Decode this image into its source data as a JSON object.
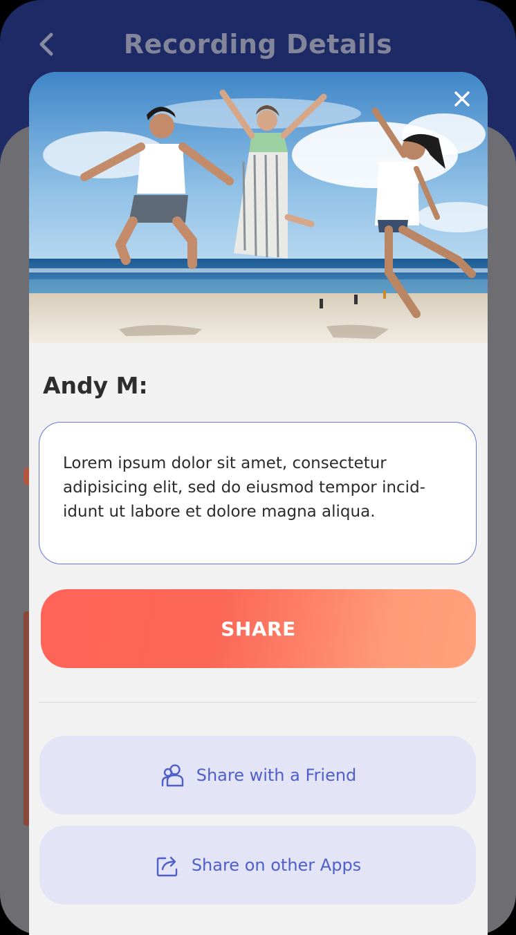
{
  "background": {
    "title": "Recording Details",
    "back_icon": "chevron-left-icon"
  },
  "modal": {
    "image_alt": "Three friends jumping on a beach",
    "close_icon": "close-icon",
    "author": "Andy M:",
    "message": "Lorem ipsum dolor sit amet, consectetur adipisicing elit, sed do eiusmod tempor incid-idunt ut labore et dolore magna aliqua.",
    "share_label": "SHARE",
    "options": [
      {
        "label": "Share with a Friend",
        "icon": "users-icon"
      },
      {
        "label": "Share on other Apps",
        "icon": "share-icon"
      }
    ]
  },
  "colors": {
    "accent": "#4f5fca",
    "share_gradient_start": "#ff6457",
    "share_gradient_end": "#ffa27c",
    "header_bg": "#1c2a66"
  }
}
